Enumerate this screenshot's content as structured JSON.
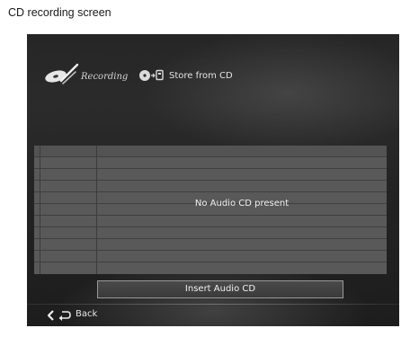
{
  "caption": "CD recording screen",
  "header": {
    "title": "Recording",
    "breadcrumb_label": "Store from CD",
    "icons": [
      "recording-disc-icon",
      "cd-to-storage-icon"
    ]
  },
  "track_list": {
    "empty_message": "No Audio CD present",
    "row_count": 10
  },
  "actions": {
    "insert_label": "Insert Audio CD"
  },
  "footer": {
    "back_label": "Back",
    "icons": [
      "chevron-left-icon",
      "return-arrow-icon"
    ]
  },
  "colors": {
    "screen_bg": "#262626",
    "table_bg": "#595959",
    "text": "#e8e8e8"
  }
}
